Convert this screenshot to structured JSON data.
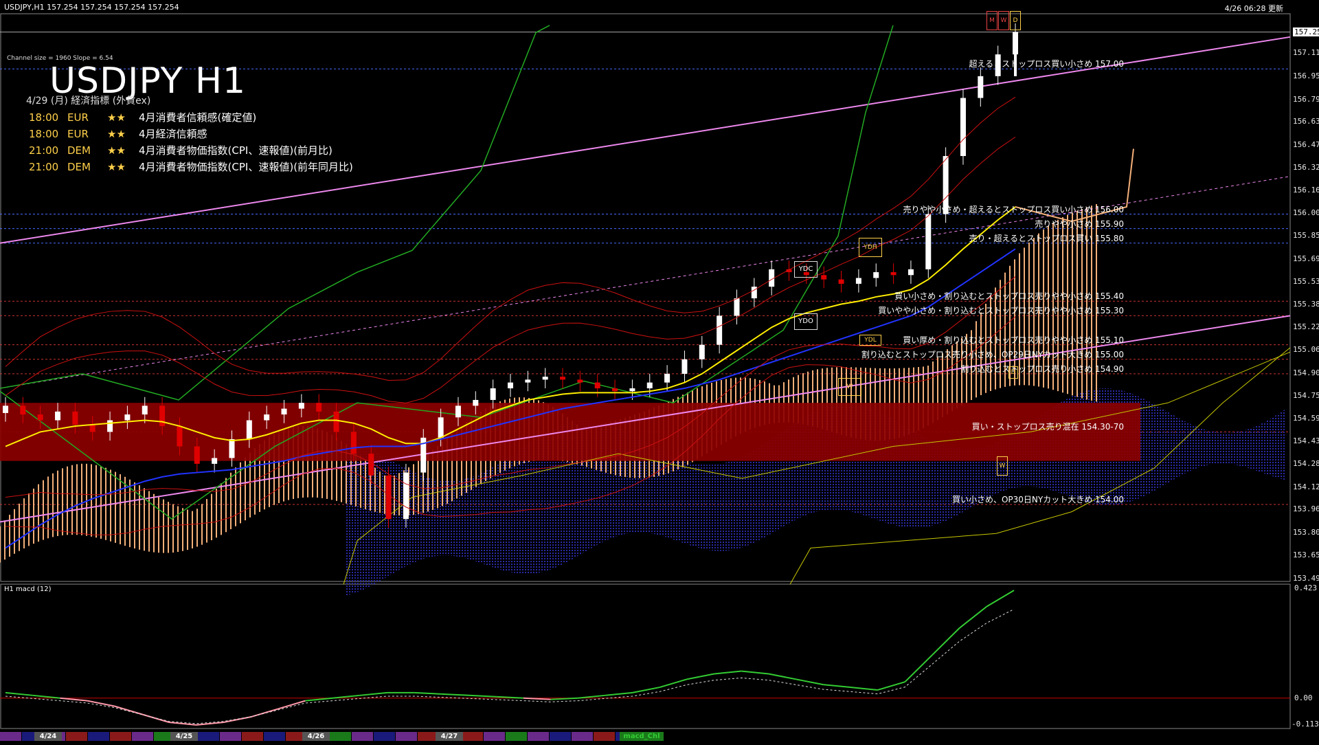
{
  "header": {
    "symbol_info": "USDJPY,H1  157.254 157.254 157.254 157.254",
    "timestamp": "4/26 06:28 更新"
  },
  "title": "USDJPY H1",
  "channel_info": "Channel size = 1960 Slope = 6.54",
  "events_heading": "4/29 (月) 経済指標 (外貨ex)",
  "events": [
    {
      "time": "18:00",
      "country": "EUR",
      "stars": "★★",
      "name": "4月消費者信頼感(確定値)"
    },
    {
      "time": "18:00",
      "country": "EUR",
      "stars": "★★",
      "name": "4月経済信頼感"
    },
    {
      "time": "21:00",
      "country": "DEM",
      "stars": "★★",
      "name": "4月消費者物価指数(CPI、速報値)(前月比)"
    },
    {
      "time": "21:00",
      "country": "DEM",
      "stars": "★★",
      "name": "4月消費者物価指数(CPI、速報値)(前年同月比)"
    }
  ],
  "annotations": [
    {
      "text": "超えるとストップロス買い小さめ 157.00",
      "price": 157.0
    },
    {
      "text": "売りやや小さめ・超えるとストップロス買い小さめ 156.00",
      "price": 156.0
    },
    {
      "text": "売りやや小さめ 155.90",
      "price": 155.9
    },
    {
      "text": "売り・超えるとストップロス買い 155.80",
      "price": 155.8
    },
    {
      "text": "買い小さめ・割り込むとストップロス売りやや小さめ 155.40",
      "price": 155.4
    },
    {
      "text": "買いやや小さめ・割り込むとストップロス売りやや小さめ 155.30",
      "price": 155.3
    },
    {
      "text": "買い厚め・割り込むとストップロス売りやや小さめ 155.10",
      "price": 155.1
    },
    {
      "text": "割り込むとストップロス売り小さめ、OP29日NYカット大きめ 155.00",
      "price": 155.0
    },
    {
      "text": "割り込むとストップロス売り小さめ 154.90",
      "price": 154.9
    },
    {
      "text": "買い・ストップロス売り混在 154.30-70",
      "price": 154.5
    },
    {
      "text": "買い小さめ、OP30日NYカット大きめ 154.00",
      "price": 154.0
    }
  ],
  "tags": {
    "m": "M",
    "w": "W",
    "d": "D",
    "ydh": "YDH",
    "ydc": "YDC",
    "ydo": "YDO",
    "ydl": "YDL",
    "w2": "W",
    "d2": "D",
    "w3": "W"
  },
  "macd_label": "H1  macd (12)",
  "macd_axis": {
    "top": "0.423",
    "zero": "0.00",
    "bottom": "-0.113"
  },
  "bottom_tabs": [
    {
      "label": "4/24"
    },
    {
      "label": "4/25"
    },
    {
      "label": "4/26"
    },
    {
      "label": "4/27"
    },
    {
      "label": "macd_Chl"
    }
  ],
  "colors": {
    "bull": "#ffffff",
    "bear": "#e00000",
    "ma_yellow": "#ffee00",
    "ma_blue": "#2233ff",
    "channel": "#ee88ee",
    "cloud_bull": "#f4b07a",
    "cloud_bear": "#1a1a80",
    "zone": "#8b0000",
    "macd_main": "#33cc33",
    "macd_neg": "#ff99aa",
    "green_band": "#22aa22"
  },
  "chart_data": {
    "type": "line",
    "title": "USDJPY H1",
    "ylim": [
      153.47,
      157.38
    ],
    "y_ticks": [
      157.254,
      157.11,
      156.95,
      156.79,
      156.635,
      156.475,
      156.32,
      156.165,
      156.005,
      155.85,
      155.69,
      155.535,
      155.38,
      155.22,
      155.065,
      154.905,
      154.75,
      154.59,
      154.435,
      154.28,
      154.12,
      153.965,
      153.805,
      153.65,
      153.49
    ],
    "x_labels": [
      "4/24",
      "4/25",
      "4/26",
      "4/27"
    ],
    "series": [
      {
        "name": "close",
        "values": [
          154.68,
          154.62,
          154.58,
          154.64,
          154.55,
          154.5,
          154.58,
          154.62,
          154.68,
          154.54,
          154.4,
          154.28,
          154.32,
          154.45,
          154.58,
          154.62,
          154.66,
          154.7,
          154.64,
          154.5,
          154.35,
          154.2,
          153.9,
          154.22,
          154.46,
          154.6,
          154.68,
          154.72,
          154.8,
          154.84,
          154.86,
          154.88,
          154.86,
          154.84,
          154.8,
          154.78,
          154.8,
          154.84,
          154.9,
          155.0,
          155.1,
          155.3,
          155.42,
          155.5,
          155.62,
          155.6,
          155.58,
          155.55,
          155.52,
          155.56,
          155.6,
          155.58,
          155.62,
          156.0,
          156.4,
          156.8,
          156.95,
          157.1,
          157.254
        ]
      },
      {
        "name": "ma_fast",
        "values": [
          154.4,
          154.45,
          154.5,
          154.52,
          154.54,
          154.55,
          154.56,
          154.57,
          154.58,
          154.57,
          154.54,
          154.5,
          154.46,
          154.44,
          154.45,
          154.48,
          154.52,
          154.56,
          154.58,
          154.58,
          154.56,
          154.52,
          154.46,
          154.42,
          154.42,
          154.46,
          154.52,
          154.58,
          154.64,
          154.68,
          154.72,
          154.74,
          154.76,
          154.77,
          154.77,
          154.77,
          154.77,
          154.78,
          154.8,
          154.84,
          154.9,
          154.98,
          155.06,
          155.14,
          155.22,
          155.28,
          155.32,
          155.35,
          155.38,
          155.4,
          155.43,
          155.45,
          155.48,
          155.55,
          155.65,
          155.76,
          155.86,
          155.96,
          156.05
        ]
      },
      {
        "name": "ma_slow",
        "values": [
          153.7,
          153.78,
          153.86,
          153.93,
          153.99,
          154.04,
          154.08,
          154.12,
          154.16,
          154.19,
          154.21,
          154.22,
          154.23,
          154.24,
          154.26,
          154.28,
          154.3,
          154.33,
          154.35,
          154.37,
          154.39,
          154.4,
          154.4,
          154.4,
          154.42,
          154.45,
          154.48,
          154.51,
          154.54,
          154.57,
          154.6,
          154.63,
          154.66,
          154.68,
          154.7,
          154.72,
          154.74,
          154.76,
          154.78,
          154.8,
          154.83,
          154.86,
          154.9,
          154.94,
          154.98,
          155.02,
          155.06,
          155.1,
          155.14,
          155.18,
          155.22,
          155.26,
          155.3,
          155.36,
          155.44,
          155.52,
          155.6,
          155.68,
          155.76
        ]
      }
    ]
  }
}
